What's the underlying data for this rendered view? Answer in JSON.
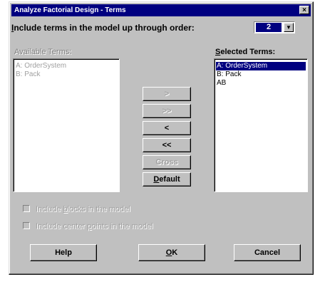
{
  "window": {
    "title": "Analyze Factorial Design - Terms",
    "close_label": "×"
  },
  "order": {
    "label_pre": "",
    "label_u": "I",
    "label_post": "nclude terms in the model up through order:",
    "value": "2",
    "arrow": "▼"
  },
  "available": {
    "label": "Available Terms:",
    "items": [
      "A: OrderSystem",
      "B: Pack"
    ]
  },
  "selected": {
    "label_u": "S",
    "label_post": "elected Terms:",
    "items": [
      "A: OrderSystem",
      "B: Pack",
      "AB"
    ]
  },
  "buttons": {
    "add": ">",
    "add_all": ">>",
    "remove": "<",
    "remove_all": "<<",
    "cross": "Cross",
    "default_u": "D",
    "default_post": "efault"
  },
  "options": {
    "blocks_pre": "Include ",
    "blocks_u": "b",
    "blocks_post": "locks in the model",
    "center_pre": "Include center ",
    "center_u": "p",
    "center_post": "oints in the model"
  },
  "footer": {
    "help": "Help",
    "ok_u": "O",
    "ok_post": "K",
    "cancel": "Cancel"
  }
}
